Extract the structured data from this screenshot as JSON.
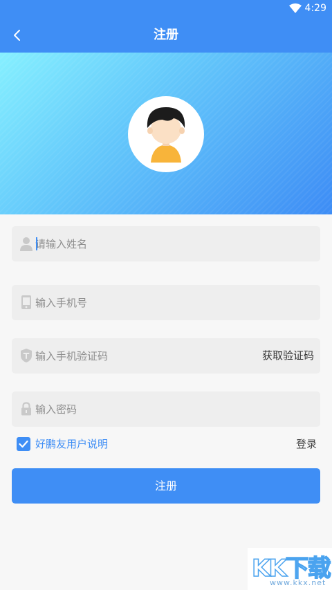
{
  "status_bar": {
    "time": "4:29"
  },
  "app_bar": {
    "title": "注册"
  },
  "form": {
    "name": {
      "placeholder": "请输入姓名"
    },
    "phone": {
      "placeholder": "输入手机号"
    },
    "code": {
      "placeholder": "输入手机验证码",
      "button_label": "获取验证码"
    },
    "password": {
      "placeholder": "输入密码"
    },
    "agreement": {
      "label": "好鹏友用户说明",
      "checked": true
    },
    "login_link": "登录",
    "submit_label": "注册"
  },
  "watermark": {
    "logo": "KK下载",
    "url": "www.kkx.net"
  },
  "colors": {
    "accent": "#3f8ef5",
    "field_bg": "#eeeeee",
    "page_bg": "#f7f7f7"
  },
  "icons": [
    "wifi-icon",
    "back-arrow-icon",
    "avatar-icon",
    "person-icon",
    "phone-icon",
    "shield-icon",
    "lock-icon",
    "checkmark-icon"
  ]
}
